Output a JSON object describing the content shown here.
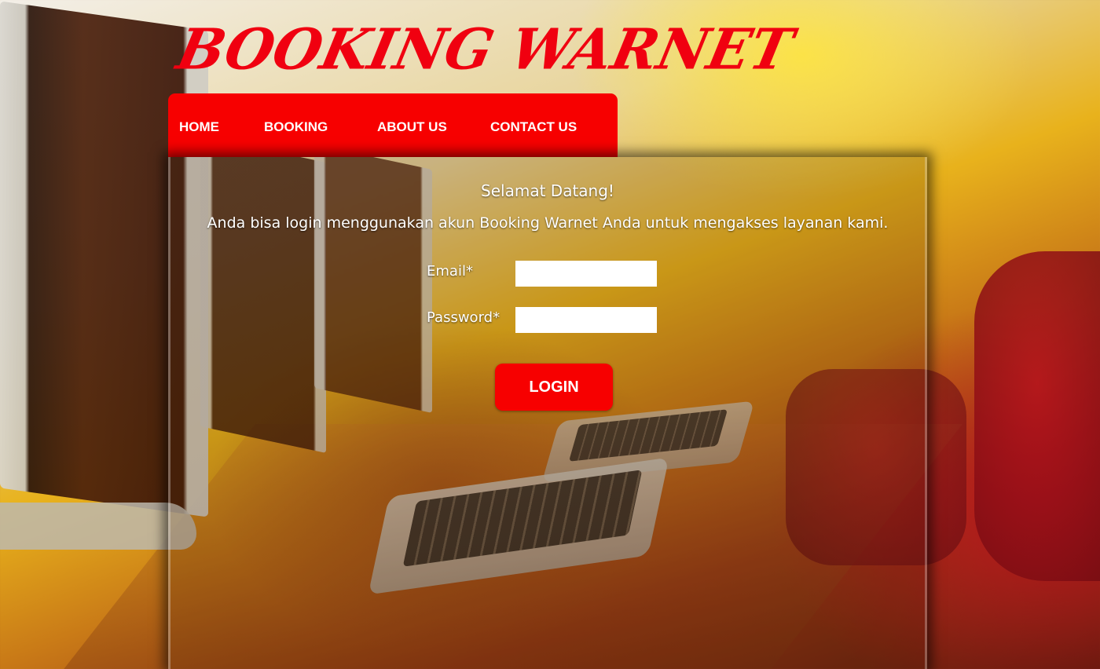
{
  "header": {
    "site_title": "BOOKING WARNET"
  },
  "nav": {
    "items": [
      {
        "label": "HOME"
      },
      {
        "label": "BOOKING"
      },
      {
        "label": "ABOUT US"
      },
      {
        "label": "CONTACT US"
      }
    ]
  },
  "login": {
    "welcome": "Selamat Datang!",
    "subtitle": "Anda bisa login menggunakan akun Booking Warnet Anda untuk mengakses layanan kami.",
    "email_label": "Email*",
    "email_value": "",
    "password_label": "Password*",
    "password_value": "",
    "submit_label": "LOGIN"
  },
  "theme": {
    "brand_red": "#f70000",
    "title_red": "#f00010",
    "text_white": "#ffffff"
  }
}
